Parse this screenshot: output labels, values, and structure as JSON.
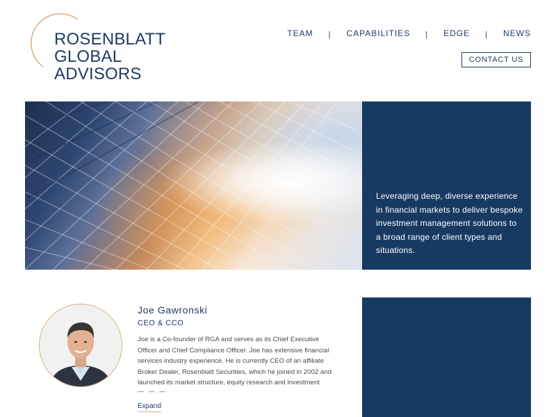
{
  "brand": {
    "name_line1": "ROSENBLATT",
    "name_line2": "GLOBAL",
    "name_line3": "ADVISORS",
    "logo_icon": "circle-arc-logo-icon",
    "accent_color": "#d6a877",
    "primary_color": "#173a63"
  },
  "nav": {
    "items": [
      {
        "label": "TEAM"
      },
      {
        "label": "CAPABILITIES"
      },
      {
        "label": "EDGE"
      },
      {
        "label": "NEWS"
      }
    ],
    "separator": "|",
    "contact_label": "CONTACT US"
  },
  "hero": {
    "tagline": "Leveraging deep, diverse experience in financial markets to deliver bespoke investment management solutions to a broad range of client types and situations."
  },
  "team": {
    "member": {
      "name": "Joe Gawronski",
      "role": "CEO & CCO",
      "bio": "Joe is a Co-founder of RGA and serves as its Chief Executive Officer and Chief Compliance Officer. Joe has extensive financial services industry experience. He is currently CEO of an affiliate Broker Dealer, Rosenblatt Securities, which he joined in 2002 and launched its market structure, equity research and investment",
      "ellipsis": "— — —",
      "expand_label": "Expand"
    }
  }
}
